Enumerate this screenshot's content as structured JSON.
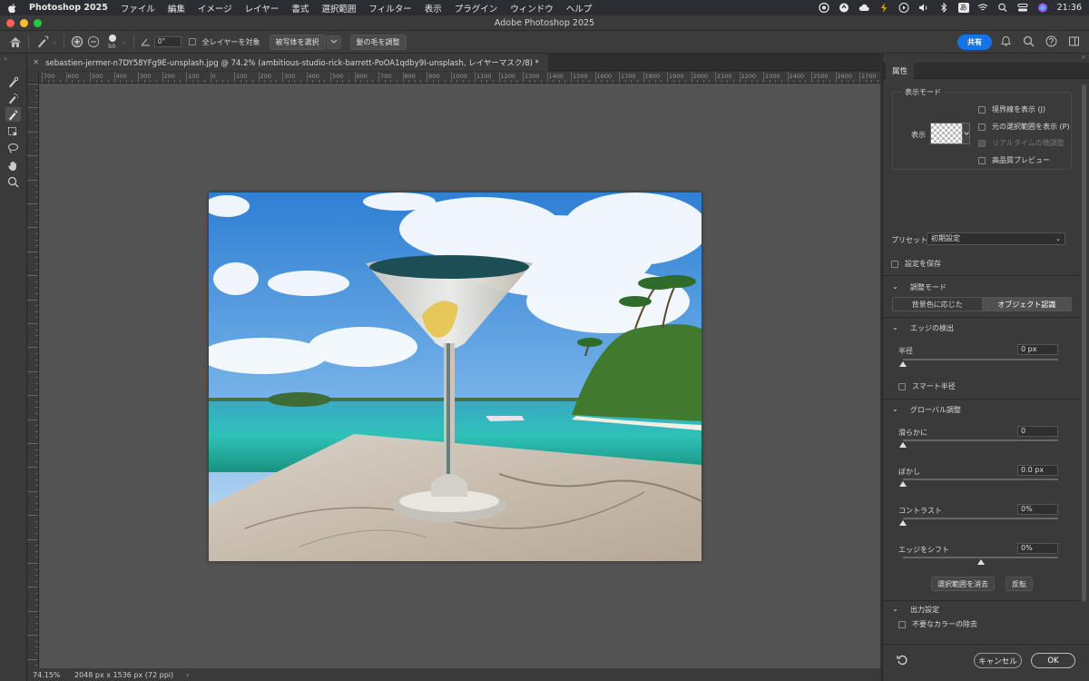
{
  "menubar": {
    "app_name": "Photoshop 2025",
    "items": [
      "ファイル",
      "編集",
      "イメージ",
      "レイヤー",
      "書式",
      "選択範囲",
      "フィルター",
      "表示",
      "プラグイン",
      "ウィンドウ",
      "ヘルプ"
    ],
    "input_mode": "あ",
    "clock": "21:36"
  },
  "window": {
    "title": "Adobe Photoshop 2025"
  },
  "options": {
    "brush_size": "50",
    "angle": "0°",
    "all_layers_label": "全レイヤーを対象",
    "select_subject_label": "被写体を選択",
    "refine_hair_label": "髪の毛を調整",
    "share_label": "共有"
  },
  "document": {
    "tab_title": "sebastien-jermer-n7DY58YFg9E-unsplash.jpg @ 74.2% (ambitious-studio-rick-barrett-PoOA1qdby9I-unsplash, レイヤーマスク/8) *",
    "close_glyph": "×"
  },
  "ruler": {
    "labels": [
      "700",
      "600",
      "500",
      "400",
      "300",
      "200",
      "100",
      "0",
      "100",
      "200",
      "300",
      "400",
      "500",
      "600",
      "700",
      "800",
      "900",
      "1000",
      "1100",
      "1200",
      "1300",
      "1400",
      "1500",
      "1600",
      "1700",
      "1800",
      "1900",
      "2000",
      "2100",
      "2200",
      "2300",
      "2400",
      "2500",
      "2600",
      "2700"
    ]
  },
  "status": {
    "zoom": "74.15%",
    "dimensions": "2048 px x 1536 px (72 ppi)",
    "arrow": "›"
  },
  "properties": {
    "tab_label": "属性",
    "view_mode": {
      "legend": "表示モード",
      "view_label": "表示",
      "show_edge": "境界線を表示 (J)",
      "show_original": "元の選択範囲を表示 (P)",
      "realtime": "リアルタイムの微調整",
      "high_quality": "高品質プレビュー"
    },
    "preset_label": "プリセット",
    "preset_value": "初期設定",
    "save_settings": "設定を保存",
    "refine_mode": {
      "title": "調整モード",
      "color_aware": "背景色に応じた",
      "object_aware": "オブジェクト認識"
    },
    "edge_detection": {
      "title": "エッジの検出",
      "radius_label": "半径",
      "radius_value": "0 px",
      "radius_level": 0,
      "smart_radius": "スマート半径"
    },
    "global": {
      "title": "グローバル調整",
      "smooth_label": "滑らかに",
      "smooth_value": "0",
      "smooth_level": 0,
      "feather_label": "ぼかし",
      "feather_value": "0.0 px",
      "feather_level": 0,
      "contrast_label": "コントラスト",
      "contrast_value": "0%",
      "contrast_level": 0,
      "shift_label": "エッジをシフト",
      "shift_value": "0%",
      "shift_level": 0.5,
      "clear_selection": "選択範囲を消去",
      "invert": "反転"
    },
    "output": {
      "title": "出力設定",
      "decontaminate": "不要なカラーの除去"
    },
    "cancel_label": "キャンセル",
    "ok_label": "OK"
  },
  "colors": {
    "accent": "#1473e6",
    "sky": "#3f8fd9",
    "sea": "#2fc1b9",
    "marble": "#cfc4b8"
  }
}
